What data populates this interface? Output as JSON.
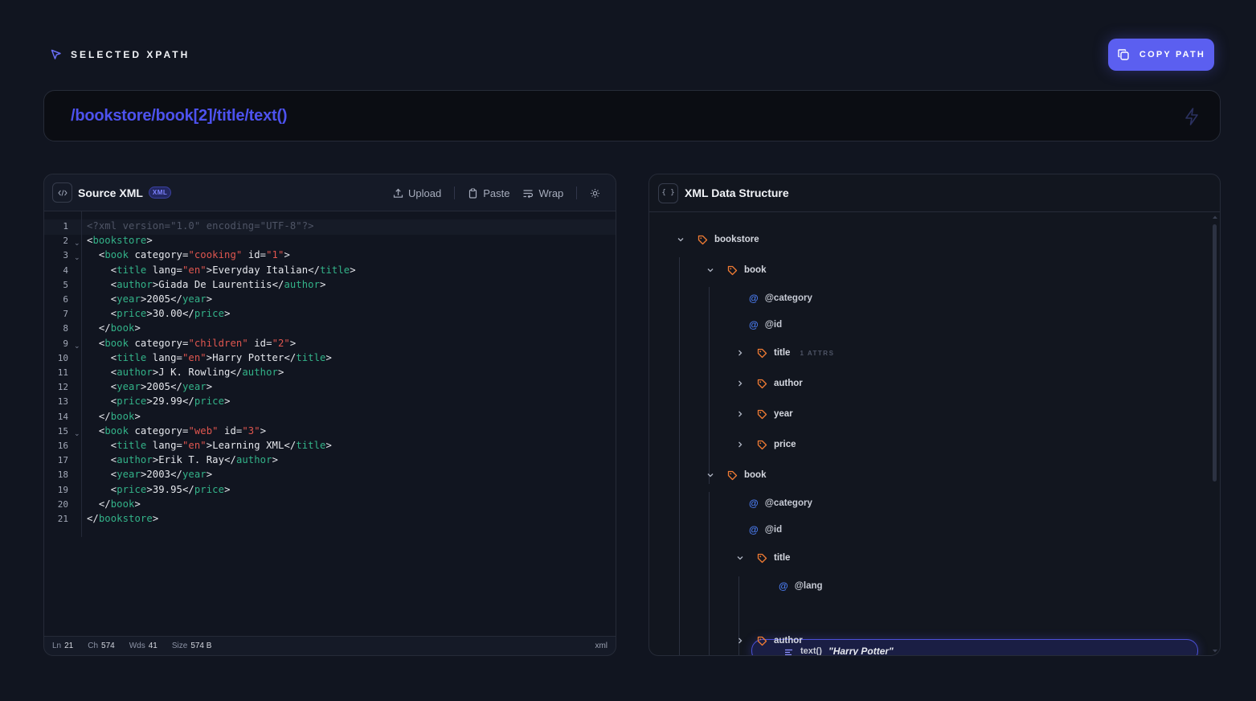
{
  "header": {
    "section_label": "SELECTED XPATH",
    "copy_button_label": "COPY PATH",
    "xpath": "/bookstore/book[2]/title/text()"
  },
  "source_panel": {
    "title": "Source XML",
    "badge": "XML",
    "toolbar": {
      "upload": "Upload",
      "paste": "Paste",
      "wrap": "Wrap"
    },
    "line_numbers": [
      "1",
      "2",
      "3",
      "4",
      "5",
      "6",
      "7",
      "8",
      "9",
      "10",
      "11",
      "12",
      "13",
      "14",
      "15",
      "16",
      "17",
      "18",
      "19",
      "20",
      "21"
    ],
    "fold_lines": [
      2,
      3,
      9,
      15
    ],
    "code": [
      "<?xml version=\"1.0\" encoding=\"UTF-8\"?>",
      "<bookstore>",
      "  <book category=\"cooking\" id=\"1\">",
      "    <title lang=\"en\">Everyday Italian</title>",
      "    <author>Giada De Laurentiis</author>",
      "    <year>2005</year>",
      "    <price>30.00</price>",
      "  </book>",
      "  <book category=\"children\" id=\"2\">",
      "    <title lang=\"en\">Harry Potter</title>",
      "    <author>J K. Rowling</author>",
      "    <year>2005</year>",
      "    <price>29.99</price>",
      "  </book>",
      "  <book category=\"web\" id=\"3\">",
      "    <title lang=\"en\">Learning XML</title>",
      "    <author>Erik T. Ray</author>",
      "    <year>2003</year>",
      "    <price>39.95</price>",
      "  </book>",
      "</bookstore>"
    ],
    "status": {
      "ln_label": "Ln",
      "ln_value": "21",
      "ch_label": "Ch",
      "ch_value": "574",
      "wds_label": "Wds",
      "wds_value": "41",
      "size_label": "Size",
      "size_value": "574 B",
      "language": "xml"
    }
  },
  "tree_panel": {
    "title": "XML Data Structure",
    "nodes": [
      {
        "kind": "element",
        "name": "bookstore",
        "expanded": true
      },
      {
        "kind": "element",
        "name": "book",
        "expanded": true
      },
      {
        "kind": "attribute",
        "name": "@category"
      },
      {
        "kind": "attribute",
        "name": "@id"
      },
      {
        "kind": "element",
        "name": "title",
        "expanded": false,
        "hint": "1 ATTRS"
      },
      {
        "kind": "element",
        "name": "author",
        "expanded": false
      },
      {
        "kind": "element",
        "name": "year",
        "expanded": false
      },
      {
        "kind": "element",
        "name": "price",
        "expanded": false
      },
      {
        "kind": "element",
        "name": "book",
        "expanded": true
      },
      {
        "kind": "attribute",
        "name": "@category"
      },
      {
        "kind": "attribute",
        "name": "@id"
      },
      {
        "kind": "element",
        "name": "title",
        "expanded": true
      },
      {
        "kind": "attribute",
        "name": "@lang"
      },
      {
        "kind": "text",
        "name": "text()",
        "value": "\"Harry Potter\"",
        "selected": true
      },
      {
        "kind": "element",
        "name": "author",
        "expanded": false
      }
    ]
  },
  "colors": {
    "accent": "#5b5ff0",
    "xpath_text": "#4d52ee",
    "xml_tag": "#33b389",
    "xml_string": "#e0564f",
    "tree_tag_icon": "#f07b33",
    "tree_attr_icon": "#4b7cf0"
  }
}
